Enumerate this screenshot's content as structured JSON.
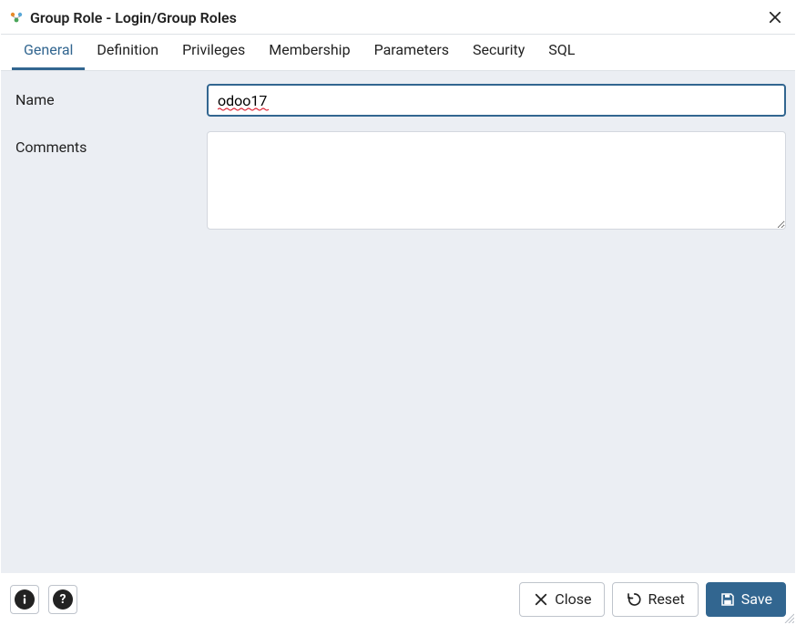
{
  "header": {
    "title": "Group Role - Login/Group Roles"
  },
  "tabs": [
    {
      "id": "general",
      "label": "General",
      "active": true
    },
    {
      "id": "definition",
      "label": "Definition",
      "active": false
    },
    {
      "id": "privileges",
      "label": "Privileges",
      "active": false
    },
    {
      "id": "membership",
      "label": "Membership",
      "active": false
    },
    {
      "id": "parameters",
      "label": "Parameters",
      "active": false
    },
    {
      "id": "security",
      "label": "Security",
      "active": false
    },
    {
      "id": "sql",
      "label": "SQL",
      "active": false
    }
  ],
  "form": {
    "name_label": "Name",
    "name_value": "odoo17",
    "comments_label": "Comments",
    "comments_value": ""
  },
  "footer": {
    "close_label": "Close",
    "reset_label": "Reset",
    "save_label": "Save"
  }
}
